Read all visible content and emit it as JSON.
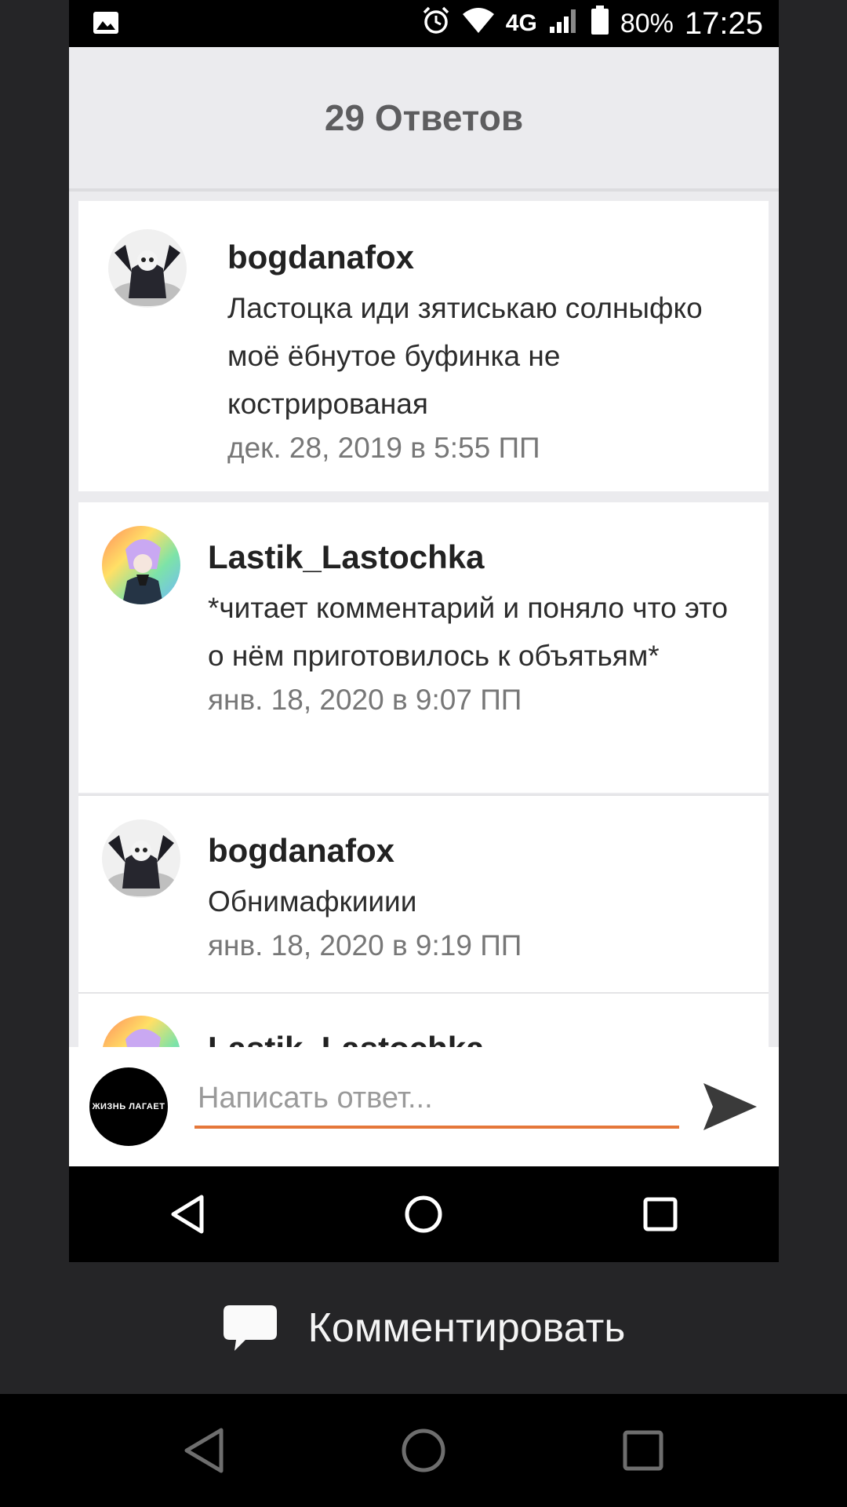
{
  "status_bar": {
    "network": "4G",
    "battery": "80%",
    "time": "17:25",
    "icons": [
      "image-icon",
      "alarm-icon",
      "wifi-icon",
      "signal-icon",
      "battery-icon"
    ]
  },
  "header": {
    "title": "29 Ответов"
  },
  "comments": [
    {
      "username": "bogdanafox",
      "text": "Ластоцка иди зятиськаю солныфко моё ёбнутое буфинка не кострированая",
      "date": "дек. 28, 2019 в 5:55 ПП"
    },
    {
      "username": "Lastik_Lastochka",
      "text": "*читает комментарий и поняло что это о нём приготовилось к объятьям*",
      "date": "янв. 18, 2020 в 9:07 ПП"
    },
    {
      "username": "bogdanafox",
      "text": "Обнимафкииии",
      "date": "янв. 18, 2020 в 9:19 ПП"
    },
    {
      "username": "Lastik_Lastochka"
    }
  ],
  "reply": {
    "avatar_text": "ЖИЗНЬ ЛАГАЕТ",
    "placeholder": "Написать ответ...",
    "accent_color": "#e5773a"
  },
  "comment_bar": {
    "label": "Комментировать"
  }
}
